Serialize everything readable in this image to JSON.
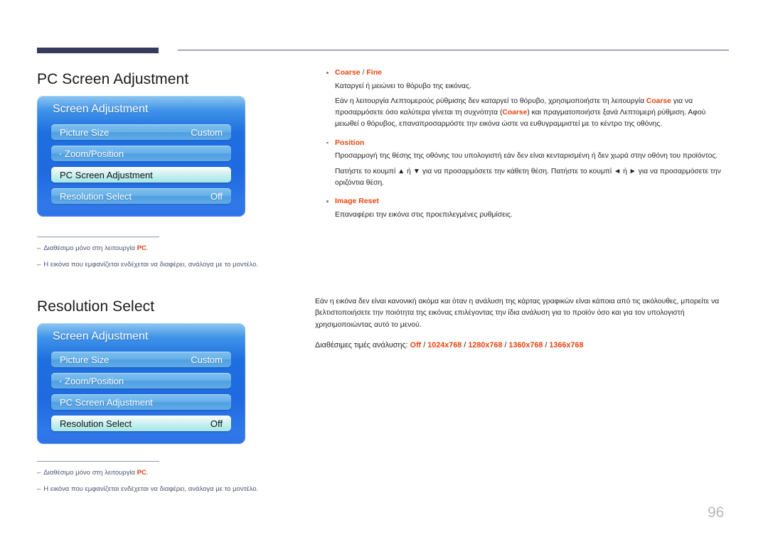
{
  "page": {
    "number": "96"
  },
  "sections": [
    {
      "heading": "PC Screen Adjustment",
      "osd": {
        "title": "Screen Adjustment",
        "rows": [
          {
            "label": "Picture Size",
            "value": "Custom",
            "selected": false,
            "dot": false
          },
          {
            "label": "Zoom/Position",
            "value": "",
            "selected": false,
            "dot": true
          },
          {
            "label": "PC Screen Adjustment",
            "value": "",
            "selected": true,
            "dot": false
          },
          {
            "label": "Resolution Select",
            "value": "Off",
            "selected": false,
            "dot": false
          }
        ]
      },
      "footnotes": [
        {
          "dash": "–",
          "text_before": "Διαθέσιμο μόνο στη λειτουργία ",
          "strong": "PC",
          "text_after": "."
        },
        {
          "dash": "–",
          "text_before": "Η εικόνα που εμφανίζεται ενδέχεται να διαφέρει, ανάλογα με το μοντέλο.",
          "strong": "",
          "text_after": ""
        }
      ]
    },
    {
      "heading": "Resolution Select",
      "osd": {
        "title": "Screen Adjustment",
        "rows": [
          {
            "label": "Picture Size",
            "value": "Custom",
            "selected": false,
            "dot": false
          },
          {
            "label": "Zoom/Position",
            "value": "",
            "selected": false,
            "dot": true
          },
          {
            "label": "PC Screen Adjustment",
            "value": "",
            "selected": false,
            "dot": false
          },
          {
            "label": "Resolution Select",
            "value": "Off",
            "selected": true,
            "dot": false
          }
        ]
      },
      "footnotes": [
        {
          "dash": "–",
          "text_before": "Διαθέσιμο μόνο στη λειτουργία ",
          "strong": "PC",
          "text_after": "."
        },
        {
          "dash": "–",
          "text_before": "Η εικόνα που εμφανίζεται ενδέχεται να διαφέρει, ανάλογα με το μοντέλο.",
          "strong": "",
          "text_after": ""
        }
      ]
    }
  ],
  "right_column_one": {
    "bullets": [
      {
        "title_a": "Coarse",
        "separator": " / ",
        "title_b": "Fine",
        "paragraphs": [
          {
            "p1": "Καταργεί ή μειώνει το θόρυβο της εικόνας."
          },
          {
            "seg1": "Εάν η λειτουργία Λεπτομερούς ρύθμισης δεν καταργεί το θόρυβο, χρησιμοποιήστε τη λειτουργία ",
            "acc1": "Coarse",
            "seg2": " για να προσαρμόσετε όσο καλύτερα γίνεται τη συχνότητα (",
            "acc2": "Coarse",
            "seg3": ") και πραγματοποιήστε ξανά Λεπτομερή ρύθμιση. Αφού μειωθεί ο θόρυβος, επαναπροσαρμόστε την εικόνα ώστε να ευθυγραμμιστεί με το κέντρο της οθόνης."
          }
        ]
      },
      {
        "title_a": "Position",
        "separator": "",
        "title_b": "",
        "paragraphs": [
          {
            "p1": "Προσαρμογή της θέσης της οθόνης του υπολογιστή εάν δεν είναι κενταρισμένη ή δεν χωρά στην οθόνη του προϊόντος."
          },
          {
            "p1": "Πατήστε το κουμπί ▲ ή ▼ για να προσαρμόσετε την κάθετη θέση. Πατήστε το κουμπί ◄ ή ► για να προσαρμόσετε την οριζόντια θέση."
          }
        ]
      },
      {
        "title_a": "Image Reset",
        "separator": "",
        "title_b": "",
        "paragraphs": [
          {
            "p1": "Επαναφέρει την εικόνα στις προεπιλεγμένες ρυθμίσεις."
          }
        ]
      }
    ]
  },
  "right_column_two": {
    "paragraph": "Εάν η εικόνα δεν είναι κανονική ακόμα και όταν η ανάλυση της κάρτας γραφικών είναι κάποια από τις ακόλουθες, μπορείτε να βελτιστοποιήσετε την ποιότητα της εικόνας επιλέγοντας την ίδια ανάλυση για το προϊόν όσο και για τον υπολογιστή χρησιμοποιώντας αυτό το μενού.",
    "res_label": "Διαθέσιμες τιμές ανάλυσης: ",
    "res_values": [
      "Off",
      "1024x768",
      "1280x768",
      "1360x768",
      "1366x768"
    ]
  },
  "colors": {
    "accent": "#e8440f",
    "header_bar": "#363a5c",
    "menu_blue": "#1f6fe0",
    "menu_row": "#69b2e9",
    "menu_selected": "#b9edec",
    "footnote": "#4d5470",
    "page_number": "#b9b9b9"
  }
}
